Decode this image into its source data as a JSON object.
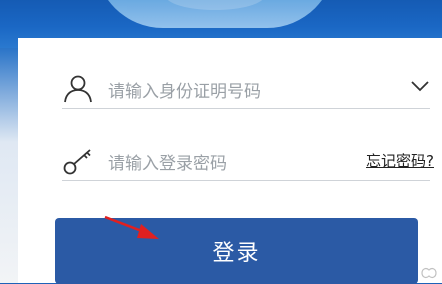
{
  "login_form": {
    "id_placeholder": "请输入身份证明号码",
    "password_placeholder": "请输入登录密码",
    "forgot_password": "忘记密码?",
    "login_button": "登录"
  },
  "icons": {
    "user": "user-icon",
    "key": "key-icon",
    "dropdown": "chevron-down-icon",
    "annotation": "red-arrow-icon"
  },
  "colors": {
    "primary": "#2b5aa5",
    "banner": "#1a67c4",
    "annotation_red": "#e02020",
    "placeholder": "#9aa0a6"
  }
}
